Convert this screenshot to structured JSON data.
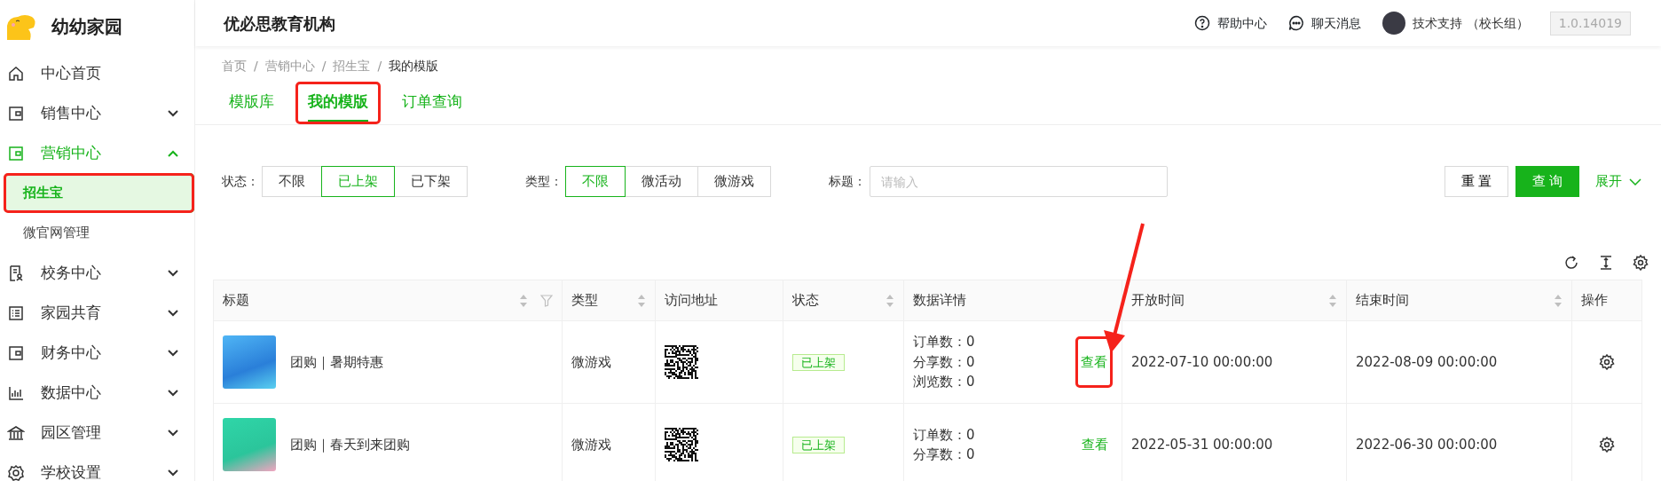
{
  "app": {
    "name": "幼幼家园"
  },
  "sidebar": {
    "items": [
      {
        "label": "中心首页",
        "selected": false
      },
      {
        "label": "销售中心",
        "selected": false,
        "expanded": false
      },
      {
        "label": "营销中心",
        "selected": true,
        "expanded": true,
        "children": [
          {
            "label": "招生宝",
            "selected": true,
            "highlighted": true
          },
          {
            "label": "微官网管理",
            "selected": false,
            "highlighted": false
          }
        ]
      },
      {
        "label": "校务中心",
        "selected": false,
        "expanded": false
      },
      {
        "label": "家园共育",
        "selected": false,
        "expanded": false
      },
      {
        "label": "财务中心",
        "selected": false,
        "expanded": false
      },
      {
        "label": "数据中心",
        "selected": false,
        "expanded": false
      },
      {
        "label": "园区管理",
        "selected": false,
        "expanded": false
      },
      {
        "label": "学校设置",
        "selected": false,
        "expanded": false
      }
    ]
  },
  "header": {
    "title": "优必思教育机构",
    "links": [
      "帮助中心",
      "聊天消息"
    ],
    "user": "技术支持 （校长组）",
    "version": "1.0.14019"
  },
  "breadcrumb": {
    "items": [
      "首页",
      "营销中心",
      "招生宝",
      "我的模版"
    ],
    "separator": "/"
  },
  "tabs": [
    {
      "label": "模版库",
      "selected": false,
      "highlighted": false
    },
    {
      "label": "我的模版",
      "selected": true,
      "highlighted": true
    },
    {
      "label": "订单查询",
      "selected": false,
      "highlighted": false
    }
  ],
  "filters": {
    "status": {
      "label": "状态：",
      "options": [
        {
          "label": "不限",
          "selected": false
        },
        {
          "label": "已上架",
          "selected": true
        },
        {
          "label": "已下架",
          "selected": false
        }
      ]
    },
    "type": {
      "label": "类型：",
      "options": [
        {
          "label": "不限",
          "selected": true
        },
        {
          "label": "微活动",
          "selected": false
        },
        {
          "label": "微游戏",
          "selected": false
        }
      ]
    },
    "title": {
      "label": "标题：",
      "placeholder": "请输入"
    },
    "reset": "重 置",
    "query": "查 询",
    "expand": "展开"
  },
  "table": {
    "columns": [
      {
        "label": "标题",
        "sortable": true,
        "filterable": true
      },
      {
        "label": "类型",
        "sortable": true,
        "filterable": false
      },
      {
        "label": "访问地址",
        "sortable": false,
        "filterable": false
      },
      {
        "label": "状态",
        "sortable": true,
        "filterable": false
      },
      {
        "label": "数据详情",
        "sortable": false,
        "filterable": false
      },
      {
        "label": "开放时间",
        "sortable": true,
        "filterable": false
      },
      {
        "label": "结束时间",
        "sortable": true,
        "filterable": false
      },
      {
        "label": "操作",
        "sortable": false,
        "filterable": false
      }
    ],
    "rows": [
      {
        "title": "团购｜暑期特惠",
        "type": "微游戏",
        "status": "已上架",
        "stats": [
          "订单数：0",
          "分享数：0",
          "浏览数：0"
        ],
        "view": "查看",
        "view_highlighted": true,
        "open": "2022-07-10 00:00:00",
        "end": "2022-08-09 00:00:00"
      },
      {
        "title": "团购｜春天到来团购",
        "type": "微游戏",
        "status": "已上架",
        "stats": [
          "订单数：0",
          "分享数：0"
        ],
        "view": "查看",
        "view_highlighted": false,
        "open": "2022-05-31 00:00:00",
        "end": "2022-06-30 00:00:00"
      }
    ]
  }
}
